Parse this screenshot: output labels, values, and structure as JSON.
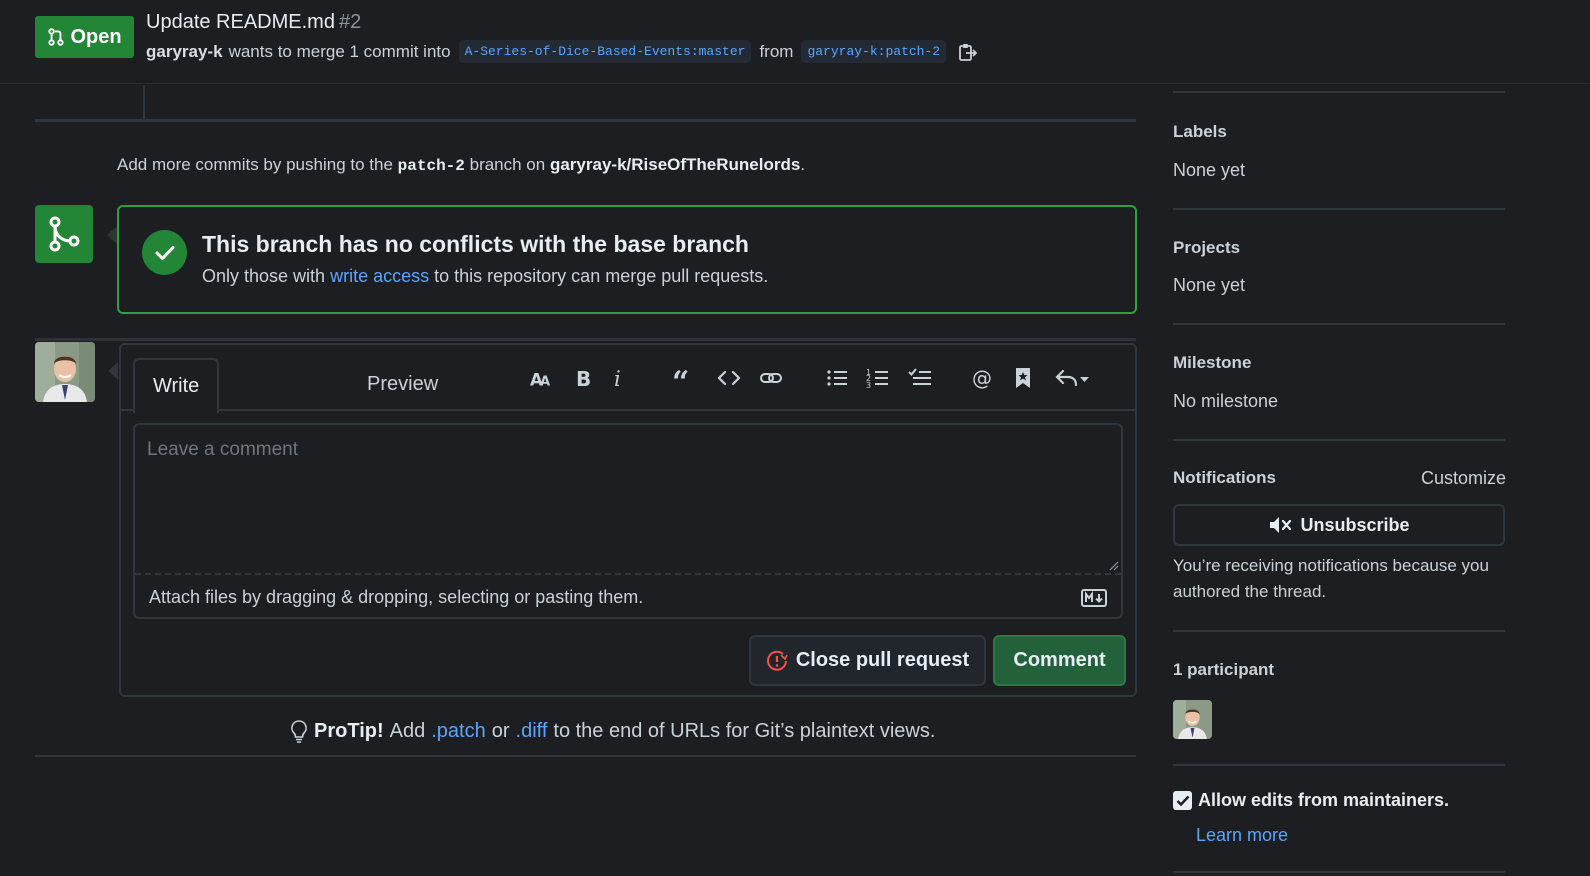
{
  "header": {
    "state": "Open",
    "title": "Update README.md",
    "number": "#2",
    "author": "garyray-k",
    "merge_text": "wants to merge 1 commit into",
    "base_branch": "A-Series-of-Dice-Based-Events:master",
    "from_text": "from",
    "head_branch": "garyray-k:patch-2"
  },
  "push_hint": {
    "prefix": "Add more commits by pushing to the",
    "branch": "patch-2",
    "middle": "branch on",
    "repo": "garyray-k/RiseOfTheRunelords",
    "suffix": "."
  },
  "merge_status": {
    "title": "This branch has no conflicts with the base branch",
    "sub_prefix": "Only those with",
    "sub_link": "write access",
    "sub_suffix": "to this repository can merge pull requests."
  },
  "comment_form": {
    "tabs": [
      "Write",
      "Preview"
    ],
    "placeholder": "Leave a comment",
    "attach_text": "Attach files by dragging & dropping, selecting or pasting them.",
    "close_button": "Close pull request",
    "comment_button": "Comment",
    "toolbar": [
      "text-size-icon",
      "bold-icon",
      "italic-icon",
      "quote-icon",
      "code-icon",
      "link-icon",
      "bulleted-list-icon",
      "numbered-list-icon",
      "task-list-icon",
      "mention-icon",
      "saved-reply-icon",
      "reply-icon"
    ]
  },
  "protip": {
    "label": "ProTip!",
    "prefix": "Add",
    "link1": ".patch",
    "middle": "or",
    "link2": ".diff",
    "suffix": "to the end of URLs for Git’s plaintext views."
  },
  "sidebar": {
    "labels": {
      "heading": "Labels",
      "value": "None yet"
    },
    "projects": {
      "heading": "Projects",
      "value": "None yet"
    },
    "milestone": {
      "heading": "Milestone",
      "value": "No milestone"
    },
    "notifications": {
      "heading": "Notifications",
      "customize": "Customize",
      "button": "Unsubscribe",
      "reason": "You’re receiving notifications because you authored the thread."
    },
    "participants": {
      "heading": "1 participant"
    },
    "maintainers": {
      "label": "Allow edits from maintainers.",
      "checked": true,
      "learn_more": "Learn more"
    }
  },
  "colors": {
    "background": "#1c1e21",
    "accent_green": "#238636",
    "link_blue": "#58a6ff",
    "danger_red": "#f85149"
  }
}
